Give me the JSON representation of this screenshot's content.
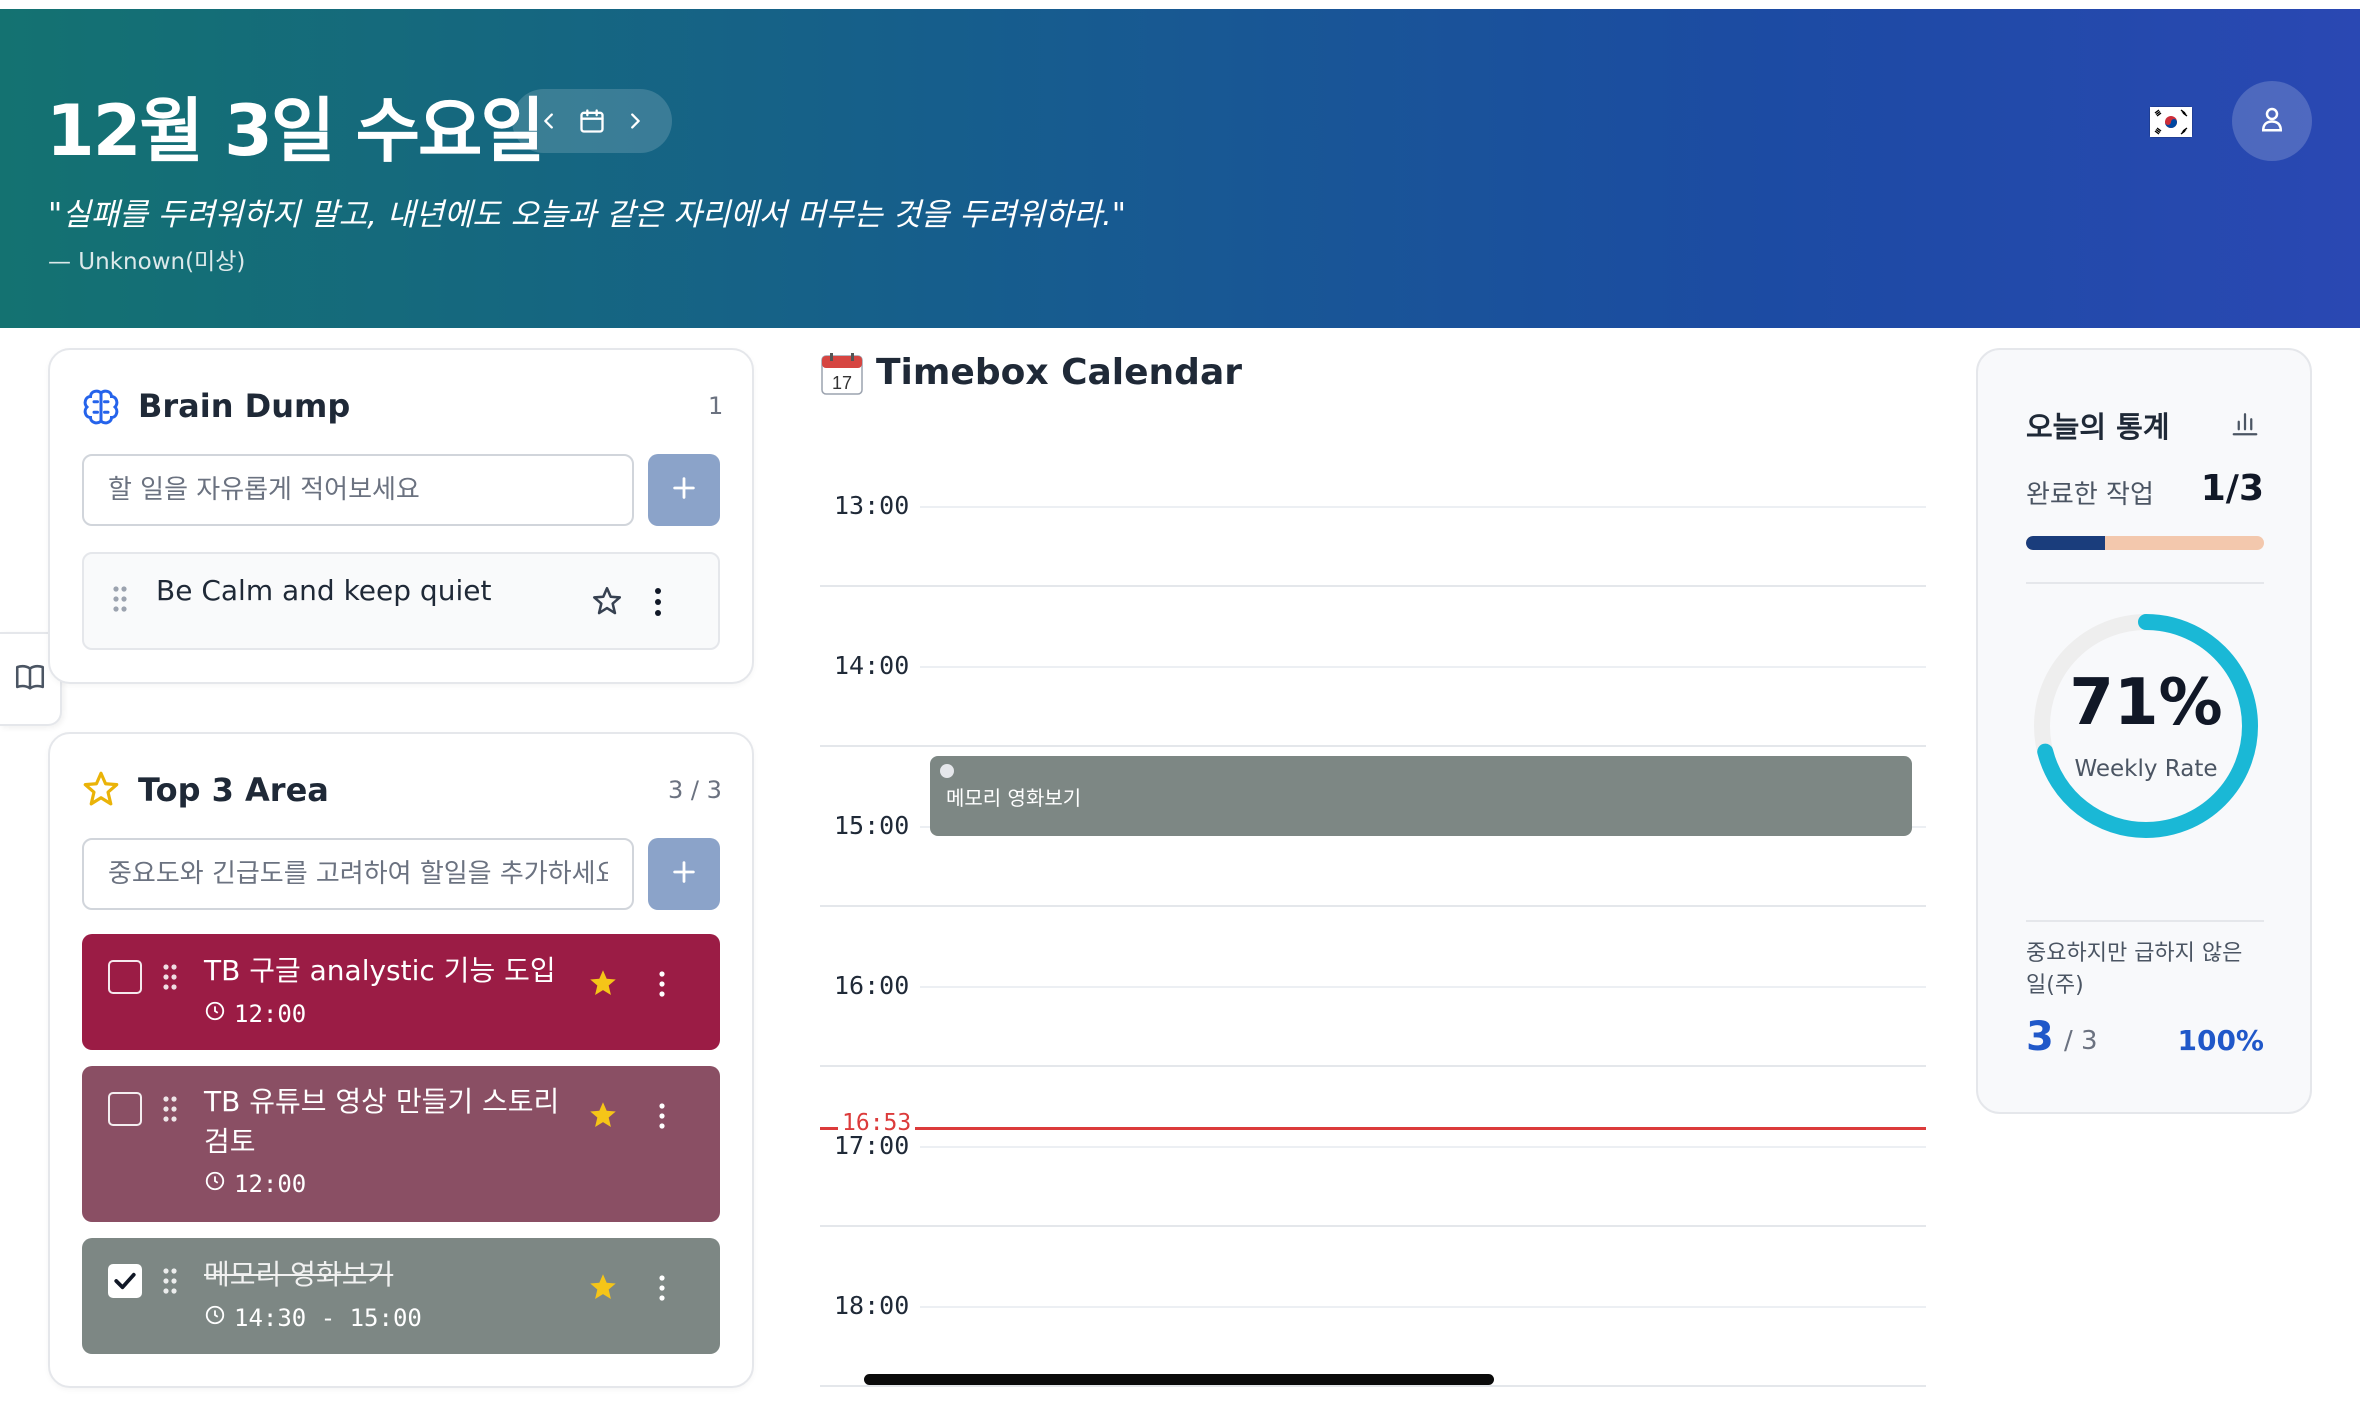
{
  "header": {
    "date_title": "12월 3일 수요일",
    "quote": "\"실패를 두려워하지 말고, 내년에도 오늘과 같은 자리에서 머무는 것을 두려워하라.\"",
    "author": "— Unknown(미상)",
    "language_flag": "south-korea-flag-icon",
    "colors": {
      "gradient_start": "#147271",
      "gradient_end": "#2a48b3"
    }
  },
  "brain_dump": {
    "title": "Brain Dump",
    "count": "1",
    "input_placeholder": "할 일을 자유롭게 적어보세요",
    "items": [
      {
        "text": "Be Calm and keep quiet",
        "starred": false
      }
    ]
  },
  "top3": {
    "title": "Top 3 Area",
    "count": "3 / 3",
    "input_placeholder": "중요도와 긴급도를 고려하여 할일을 추가하세요",
    "tasks": [
      {
        "title": "TB 구글 analystic 기능 도입",
        "time": "12:00",
        "checked": false,
        "starred": true,
        "color": "#9b1c45"
      },
      {
        "title": "TB 유튜브 영상 만들기 스토리 검토",
        "time": "12:00",
        "checked": false,
        "starred": true,
        "color": "#8a4f64"
      },
      {
        "title": "메모리 영화보기",
        "time": "14:30 - 15:00",
        "checked": true,
        "starred": true,
        "color": "#7d8784"
      }
    ]
  },
  "timebox": {
    "title": "Timebox Calendar",
    "hours": [
      "13:00",
      "14:00",
      "15:00",
      "16:00",
      "17:00",
      "18:00"
    ],
    "events": [
      {
        "label": "메모리 영화보기",
        "color": "#7d8784"
      }
    ],
    "now": "16:53",
    "now_color": "#dc3b3b"
  },
  "stats": {
    "title": "오늘의 통계",
    "completed_label": "완료한 작업",
    "completed_value": "1/3",
    "completed_fraction": 0.333,
    "weekly_rate_pct": "71%",
    "weekly_rate_value": 0.71,
    "weekly_rate_label": "Weekly Rate",
    "important_label": "중요하지만 급하지 않은 일(주)",
    "important_count": "3",
    "important_total": "/ 3",
    "important_pct": "100%",
    "accent": "#1ab8d6"
  }
}
